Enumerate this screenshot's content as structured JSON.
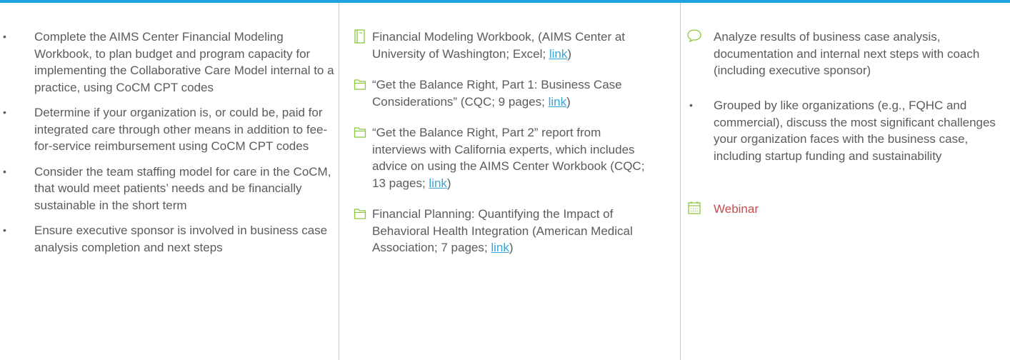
{
  "colors": {
    "accent_bar": "#1aa3e0",
    "text": "#5b5b5b",
    "link": "#3aa6d8",
    "icon_green": "#8dc63f",
    "webinar_red": "#c44f4f",
    "divider": "#c9c9c9"
  },
  "col1": {
    "items": [
      "Complete the AIMS Center Financial Modeling Workbook, to plan budget and program capacity for implementing the Collaborative Care Model internal to a practice, using CoCM CPT codes",
      "Determine if your organization is, or could be, paid for integrated care through other means in addition to fee-for-service reimbursement using CoCM CPT codes",
      "Consider the team staffing model for care in the CoCM, that would meet patients’ needs and be financially sustainable in the short term",
      "Ensure executive sponsor is involved in business case analysis completion and next steps"
    ]
  },
  "col2": {
    "resources": [
      {
        "icon": "workbook-icon",
        "text": "Financial Modeling Workbook, (AIMS Center at University of Washington; Excel; ",
        "link": "link",
        "after": ")"
      },
      {
        "icon": "folder-icon",
        "text": "“Get the Balance Right, Part 1: Business Case Considerations” (CQC; 9 pages; ",
        "link": "link",
        "after": ")"
      },
      {
        "icon": "folder-icon",
        "text": "“Get the Balance Right, Part 2” report from interviews with California experts, which includes advice on using the AIMS Center Workbook (CQC; 13 pages; ",
        "link": "link",
        "after": ")"
      },
      {
        "icon": "folder-icon",
        "text": "Financial Planning: Quantifying the Impact of Behavioral Health Integration (American Medical Association; 7 pages; ",
        "link": "link",
        "after": ")"
      }
    ]
  },
  "col3": {
    "coach": "Analyze results of business case analysis, documentation and internal next steps with coach (including executive sponsor)",
    "bullet": "Grouped by like organizations (e.g., FQHC and commercial), discuss the most significant challenges your organization faces with the business case, including startup funding and sustainability",
    "webinar": "Webinar"
  }
}
